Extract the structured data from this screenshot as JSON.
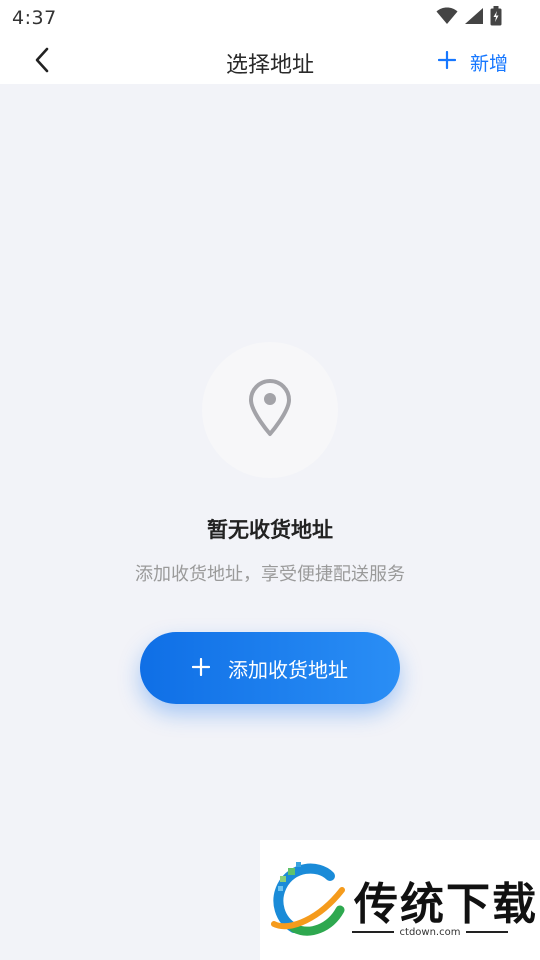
{
  "status_bar": {
    "time": "4:37"
  },
  "nav": {
    "title": "选择地址",
    "add_new_label": "新增",
    "add_new_icon": "plus-icon",
    "back_icon": "chevron-left-icon"
  },
  "empty_state": {
    "icon": "location-pin-icon",
    "title": "暂无收货地址",
    "subtitle": "添加收货地址，享受便捷配送服务"
  },
  "primary_action": {
    "icon": "plus-icon",
    "label": "添加收货地址"
  },
  "watermark": {
    "brand": "传统下载",
    "domain": "ctdown.com"
  },
  "colors": {
    "accent": "#1677ff",
    "background": "#f2f3f8",
    "button_gradient_start": "#0f6fe6",
    "button_gradient_end": "#2a8ef5"
  }
}
